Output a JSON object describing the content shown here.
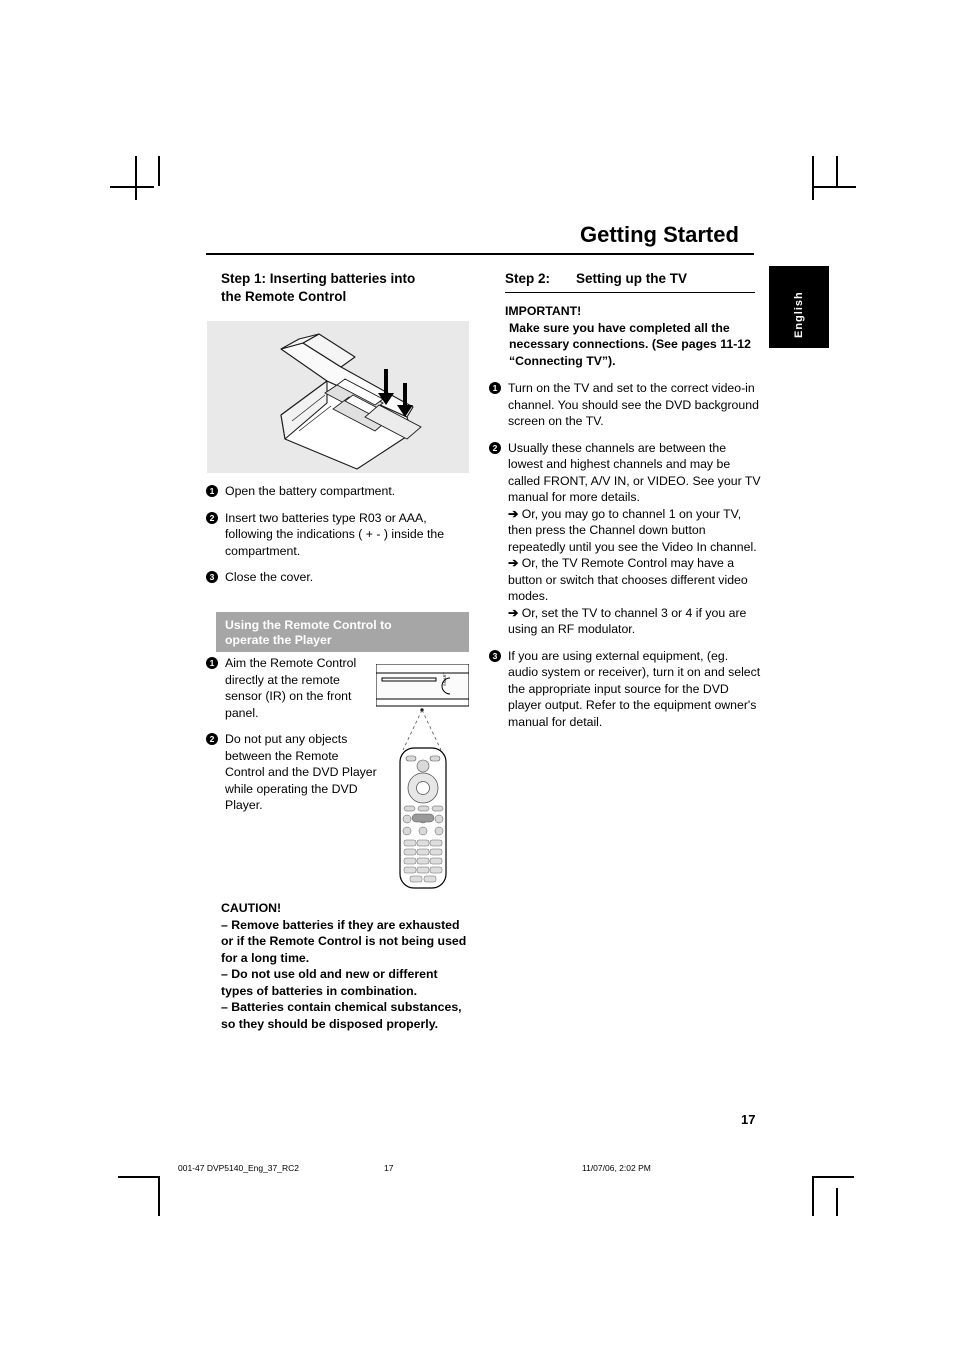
{
  "header": {
    "title": "Getting Started",
    "language_tab": "English",
    "page_number": "17"
  },
  "left_column": {
    "step1_title_line1": "Step 1:  Inserting batteries into",
    "step1_title_line2": "the Remote Control",
    "illustration_alt": "remote-control-battery-compartment",
    "steps": [
      {
        "num": "1",
        "text": "Open the battery compartment."
      },
      {
        "num": "2",
        "text": "Insert two batteries type R03 or AAA, following the indications ( + - ) inside the compartment."
      },
      {
        "num": "3",
        "text": "Close the cover."
      }
    ],
    "usage_header_line1": "Using the Remote Control to",
    "usage_header_line2": "operate the Player",
    "usage_steps": [
      {
        "num": "1",
        "text": "Aim the Remote Control directly at the remote sensor (IR) on the front panel."
      },
      {
        "num": "2",
        "text": "Do not put any objects between the Remote Control and the DVD Player while operating the DVD Player."
      }
    ],
    "caution": {
      "title": "CAUTION!",
      "lines": [
        "– Remove batteries if they are exhausted or if the Remote Control is not being used for a long time.",
        "– Do not use old and new or different types of batteries in combination.",
        "– Batteries contain chemical substances, so they should be disposed properly."
      ]
    }
  },
  "right_column": {
    "step2_label": "Step 2:",
    "step2_title": "Setting up the TV",
    "important_title": "IMPORTANT!",
    "important_text": "Make sure you have completed all the necessary connections. (See pages 11-12 “Connecting TV”).",
    "steps": [
      {
        "num": "1",
        "text": "Turn on the TV and set to the correct video-in channel. You should see the DVD background screen on the TV.",
        "subs": []
      },
      {
        "num": "2",
        "text": "Usually these channels are between the lowest and highest channels and may be called FRONT, A/V IN, or VIDEO. See your TV manual for more details.",
        "subs": [
          "Or, you may go to channel 1 on your TV, then press the Channel down button repeatedly until you see the Video In channel.",
          "Or, the TV Remote Control may have a button or switch that chooses different video modes.",
          "Or, set the TV to channel 3 or 4 if you are using an RF modulator."
        ]
      },
      {
        "num": "3",
        "text": "If you are using external equipment, (eg. audio system or receiver), turn it on and select the appropriate input source for the DVD player output. Refer to the equipment owner's manual for detail.",
        "subs": []
      }
    ]
  },
  "footer": {
    "file": "001-47 DVP5140_Eng_37_RC2",
    "page": "17",
    "timestamp": "11/07/06, 2:02 PM"
  }
}
